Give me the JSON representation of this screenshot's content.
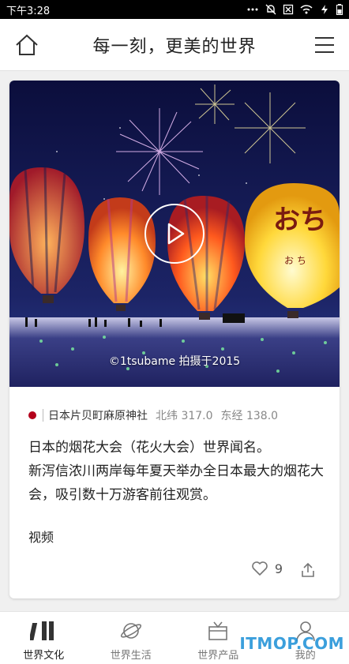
{
  "status_bar": {
    "time": "下午3:28"
  },
  "header": {
    "title": "每一刻，更美的世界"
  },
  "card": {
    "photo_credit": "©1tsubame 拍摄于2015",
    "location": {
      "name": "日本片贝町麻原神社",
      "lat": "北纬 317.0",
      "lon": "东经 138.0"
    },
    "description": [
      "日本的烟花大会（花火大会）世界闻名。",
      "新泻信浓川两岸每年夏天举办全日本最大的烟花大会，吸引数十万游客前往观赏。"
    ],
    "tag": "视频",
    "likes": "9"
  },
  "tabs": [
    {
      "label": "世界文化",
      "active": true
    },
    {
      "label": "世界生活",
      "active": false
    },
    {
      "label": "世界产品",
      "active": false
    },
    {
      "label": "我的",
      "active": false
    }
  ],
  "watermark": "ITMOP.COM",
  "colors": {
    "flag_red": "#b3001b",
    "watermark_blue": "#1a8fd6"
  }
}
